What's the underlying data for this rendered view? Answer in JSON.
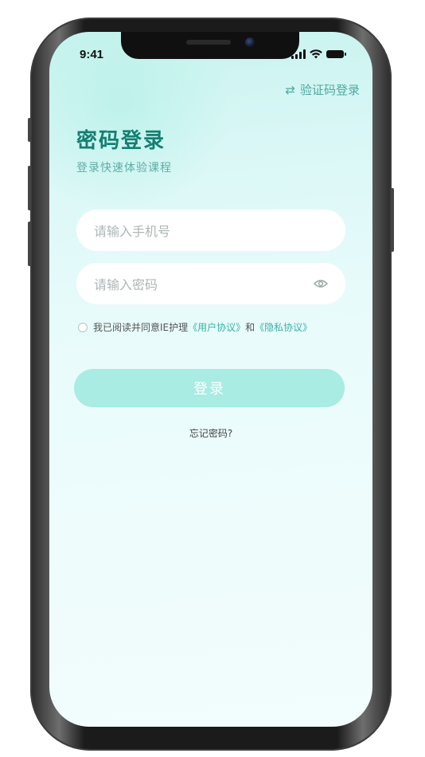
{
  "status_bar": {
    "time": "9:41"
  },
  "header": {
    "switch_label": "验证码登录",
    "switch_icon": "swap-arrows-icon"
  },
  "title": "密码登录",
  "subtitle": "登录快速体验课程",
  "form": {
    "phone_placeholder": "请输入手机号",
    "password_placeholder": "请输入密码",
    "agreement_prefix": "我已阅读并同意IE护理",
    "user_agreement": "《用户协议》",
    "agreement_and": "和",
    "privacy_policy": "《隐私协议》"
  },
  "login_button": "登录",
  "forgot_password": "忘记密码?",
  "colors": {
    "accent": "#147f72",
    "link": "#38b3a6",
    "button": "#a8ece3"
  }
}
